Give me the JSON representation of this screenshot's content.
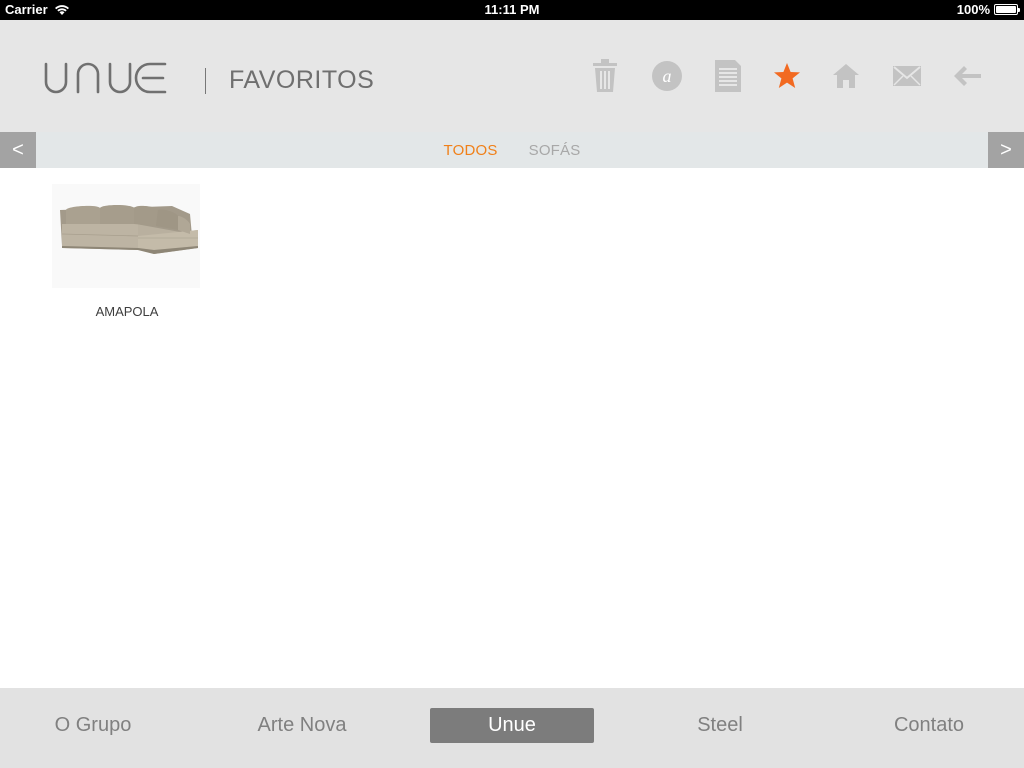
{
  "status_bar": {
    "carrier": "Carrier",
    "time": "11:11 PM",
    "battery": "100%"
  },
  "header": {
    "logo_text": "UNUE",
    "title": "FAVORITOS",
    "toolbar": [
      {
        "name": "trash-icon",
        "color": "#bfbfbf"
      },
      {
        "name": "a-circle-icon",
        "color": "#bfbfbf"
      },
      {
        "name": "document-icon",
        "color": "#bfbfbf"
      },
      {
        "name": "star-icon",
        "color": "#f26a21"
      },
      {
        "name": "home-icon",
        "color": "#bfbfbf"
      },
      {
        "name": "mail-icon",
        "color": "#bfbfbf"
      },
      {
        "name": "back-arrow-icon",
        "color": "#bfbfbf"
      }
    ]
  },
  "categories": {
    "prev_label": "<",
    "next_label": ">",
    "tabs": [
      {
        "label": "TODOS",
        "active": true
      },
      {
        "label": "SOFÁS",
        "active": false
      }
    ],
    "active_color": "#f08019"
  },
  "products": [
    {
      "name": "AMAPOLA",
      "image": "sofa-image"
    }
  ],
  "bottom_nav": {
    "items": [
      {
        "label": "O Grupo",
        "active": false
      },
      {
        "label": "Arte Nova",
        "active": false
      },
      {
        "label": "Unue",
        "active": true
      },
      {
        "label": "Steel",
        "active": false
      },
      {
        "label": "Contato",
        "active": false
      }
    ]
  }
}
